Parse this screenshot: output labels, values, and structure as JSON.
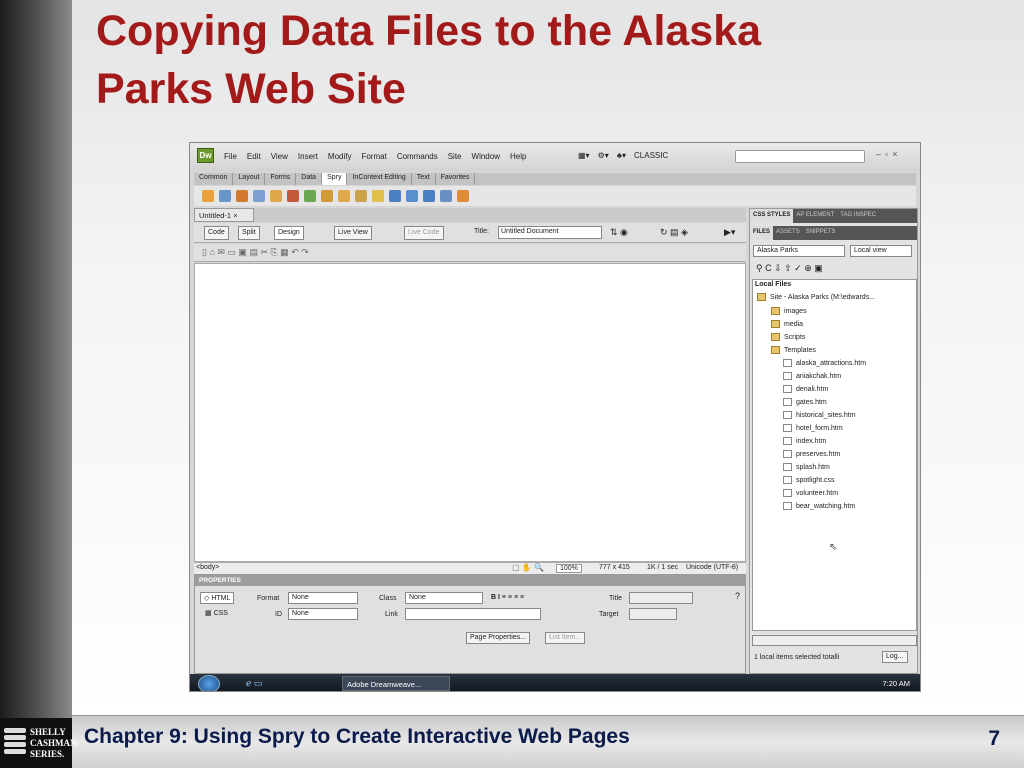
{
  "slide": {
    "title_line1": "Copying Data Files to the Alaska",
    "title_line2": "Parks Web Site",
    "footer_text": "Chapter 9: Using Spry to Create Interactive Web Pages",
    "page_number": "7",
    "logo_lines": [
      "SHELLY",
      "CASHMAN",
      "SERIES."
    ]
  },
  "app": {
    "logo": "Dw",
    "menus": [
      "File",
      "Edit",
      "View",
      "Insert",
      "Modify",
      "Format",
      "Commands",
      "Site",
      "Window",
      "Help"
    ],
    "workspace": "CLASSIC",
    "insert_tabs": [
      "Common",
      "Layout",
      "Forms",
      "Data",
      "Spry",
      "InContext Editing",
      "Text",
      "Favorites"
    ],
    "active_insert_tab": "Spry",
    "doc_tab": "Untitled-1",
    "view_buttons": {
      "code": "Code",
      "split": "Split",
      "design": "Design",
      "live_view": "Live View",
      "live_code": "Live Code"
    },
    "title_label": "Title:",
    "title_value": "Untitled Document",
    "status": {
      "tag": "<body>",
      "zoom": "100%",
      "size": "777 x 415",
      "download": "1K / 1 sec",
      "encoding": "Unicode (UTF-8)"
    },
    "properties": {
      "header": "PROPERTIES",
      "html_btn": "HTML",
      "css_btn": "CSS",
      "format_label": "Format",
      "format_value": "None",
      "class_label": "Class",
      "class_value": "None",
      "id_label": "ID",
      "id_value": "None",
      "link_label": "Link",
      "title_label": "Title",
      "target_label": "Target",
      "page_props_btn": "Page Properties...",
      "list_item_btn": "List Item..."
    },
    "panel": {
      "tabs_top": [
        "CSS STYLES",
        "AP ELEMENT",
        "TAG INSPEC"
      ],
      "tabs_files": [
        "FILES",
        "ASSETS",
        "SNIPPETS"
      ],
      "site_select": "Alaska Parks",
      "view_select": "Local view",
      "local_files_label": "Local Files",
      "root": "Site - Alaska Parks (M:\\edwards...",
      "folders": [
        "images",
        "media",
        "Scripts",
        "Templates"
      ],
      "files": [
        "alaska_attractions.htm",
        "aniakchak.htm",
        "denali.htm",
        "gates.htm",
        "historical_sites.htm",
        "hotel_form.htm",
        "index.htm",
        "preserves.htm",
        "splash.htm",
        "spotlight.css",
        "volunteer.htm",
        "bear_watching.htm"
      ],
      "status_text": "1 local items selected totalli",
      "log_btn": "Log..."
    },
    "taskbar": {
      "task": "Adobe Dreamweave...",
      "time": "7:20 AM"
    }
  }
}
